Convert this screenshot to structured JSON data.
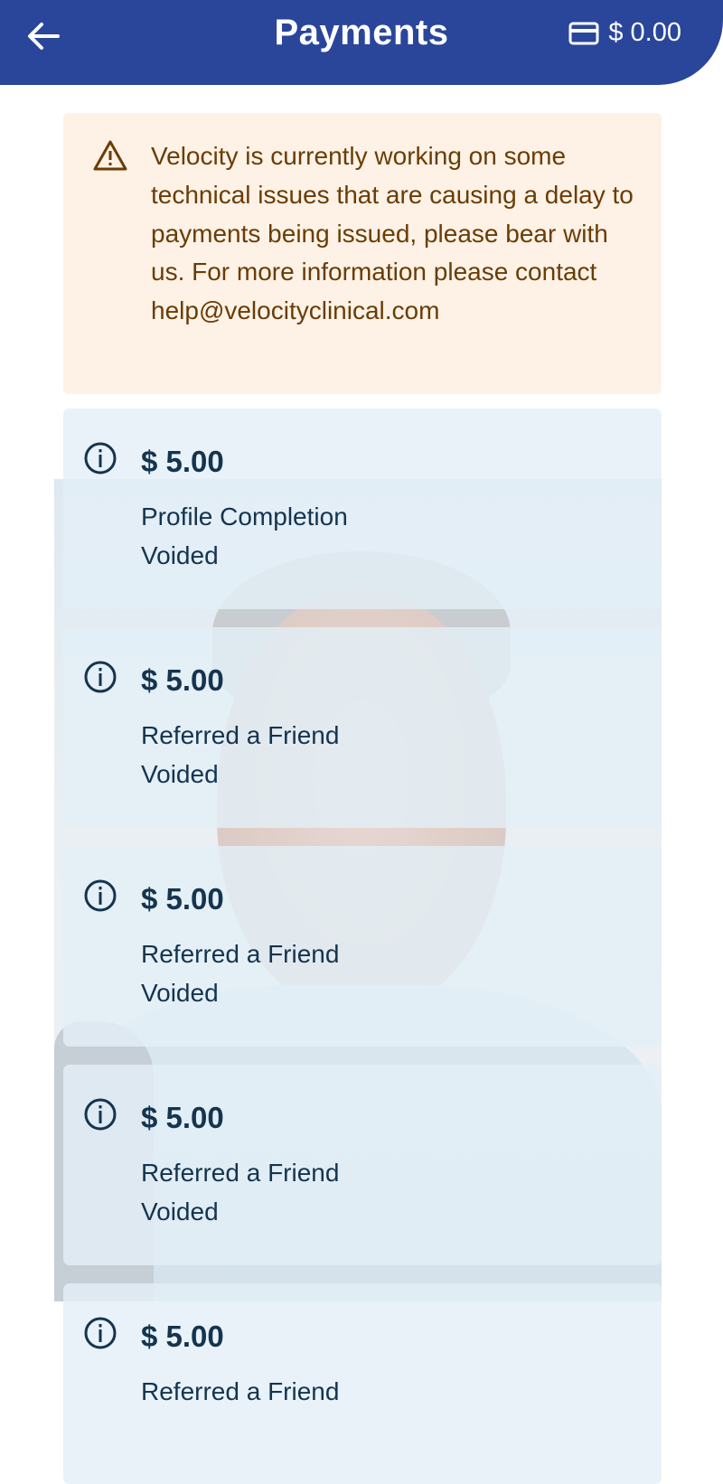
{
  "header": {
    "title": "Payments",
    "balance": "$ 0.00",
    "back_icon": "arrow-left-icon",
    "wallet_icon": "credit-card-icon",
    "background_color": "#29469a"
  },
  "notice": {
    "icon": "warning-triangle-icon",
    "text": "Velocity is currently working on some technical issues that are causing a delay to payments being issued, please bear with us. For more information please contact help@velocityclinical.com",
    "background_color": "#fdf2e5",
    "text_color": "#6b3c06"
  },
  "payments": [
    {
      "amount": "$ 5.00",
      "description": "Profile Completion",
      "status": "Voided",
      "icon": "info-icon"
    },
    {
      "amount": "$ 5.00",
      "description": "Referred a Friend",
      "status": "Voided",
      "icon": "info-icon"
    },
    {
      "amount": "$ 5.00",
      "description": "Referred a Friend",
      "status": "Voided",
      "icon": "info-icon"
    },
    {
      "amount": "$ 5.00",
      "description": "Referred a Friend",
      "status": "Voided",
      "icon": "info-icon"
    },
    {
      "amount": "$ 5.00",
      "description": "Referred a Friend",
      "status": "",
      "icon": "info-icon"
    }
  ],
  "colors": {
    "card_background": "#e3eff7",
    "card_text": "#14344f"
  }
}
